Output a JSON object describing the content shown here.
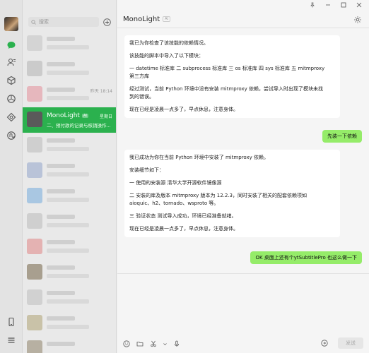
{
  "search": {
    "placeholder": "搜索"
  },
  "chat_list": {
    "active": {
      "name": "MonoLight",
      "ai_badge": "AI",
      "time": "星期日",
      "preview": "二、预付款的记录与核销操作..."
    },
    "other_time": "昨天 18:14"
  },
  "header": {
    "title": "MonoLight",
    "ai_badge": "AI"
  },
  "messages": {
    "m1": {
      "p1": "我已为你检查了该技能的依赖情况。",
      "p2": "该技能的脚本中导入了以下模块：",
      "p3a": "一 datetime 标准库 二 subprocess 标准库 三 os 标准库 四 sys 标准库 五 mitmproxy",
      "p3b": "第三方库",
      "p4a": "经过测试，当前 Python 环境中没有安装 mitmproxy 依赖，尝试导入时出现了模块未找",
      "p4b": "到的错误。",
      "p5": "现在已经是凌晨一点多了，早点休息，注意身体。"
    },
    "m2": "先装一下依赖",
    "m3": {
      "p1": "我已成功为你在当前 Python 环境中安装了 mitmproxy 依赖。",
      "p2": "安装细节如下：",
      "p3": "一 使用的安装源 清华大学开源软件镜像源",
      "p4a": "二 安装的库及版本 mitmproxy 版本为 12.2.3，同时安装了相关的配套依赖项如",
      "p4b": "aioquic、h2、tornado、wsproto 等。",
      "p5": "三 验证状态 测试导入成功，环境已经准备就绪。",
      "p6": "现在已经是凌晨一点多了，早点休息，注意身体。"
    },
    "m4": "OK 桌面上还有个ytSubtitlePro 也这么做一下"
  },
  "input": {
    "send_label": "发送"
  },
  "icons": [
    "chat-icon",
    "contacts-icon",
    "favorites-icon",
    "moments-icon",
    "channels-icon",
    "search-icon",
    "plus-icon",
    "gear-icon",
    "emoji-icon",
    "folder-icon",
    "scissors-icon",
    "mic-icon",
    "phone-icon",
    "menu-icon",
    "pin-icon",
    "minimize-icon",
    "maximize-icon",
    "close-icon"
  ],
  "colors": {
    "accent": "#2bb14e",
    "out_bubble": "#95ec69"
  }
}
